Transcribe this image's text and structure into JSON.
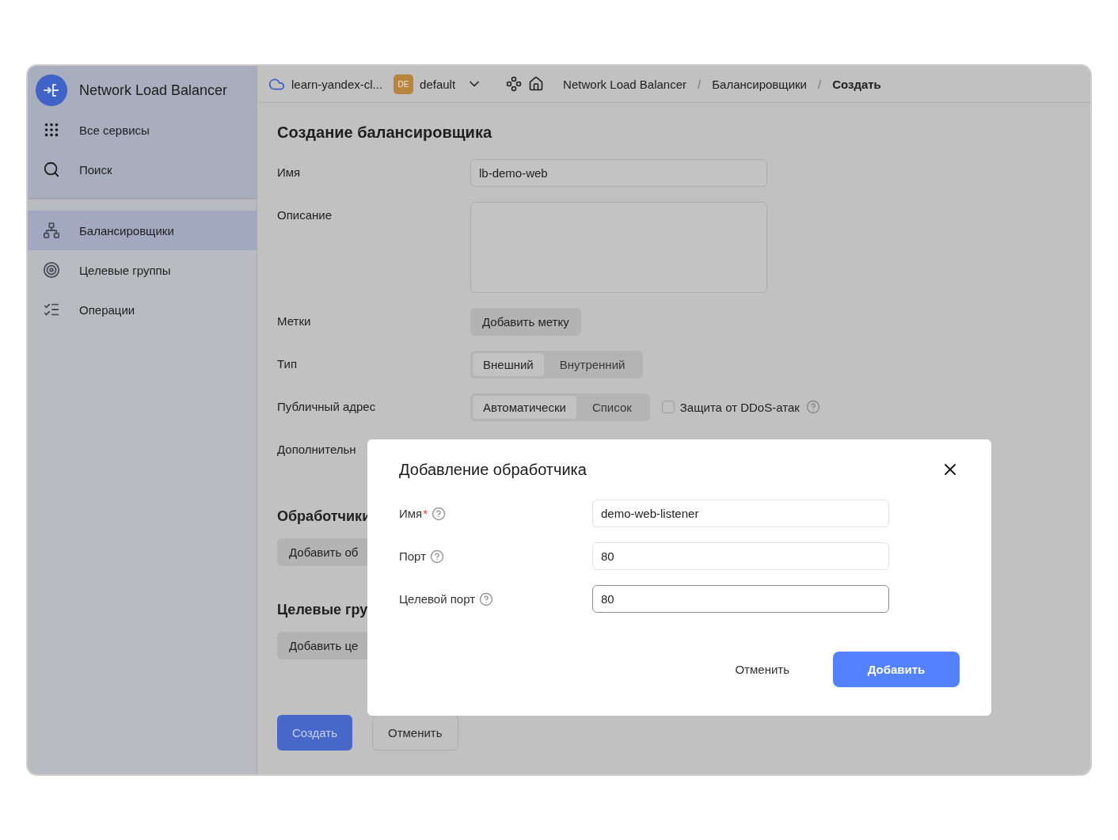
{
  "sidebar": {
    "service_title": "Network Load Balancer",
    "top_items": [
      {
        "label": "Все сервисы"
      },
      {
        "label": "Поиск"
      }
    ],
    "nav_items": [
      {
        "label": "Балансировщики",
        "selected": true
      },
      {
        "label": "Целевые группы",
        "selected": false
      },
      {
        "label": "Операции",
        "selected": false
      }
    ]
  },
  "topbar": {
    "cloud": "learn-yandex-cl...",
    "folder_badge": "DE",
    "folder": "default",
    "separator": "/",
    "breadcrumbs": [
      {
        "label": "Network Load Balancer",
        "current": false
      },
      {
        "label": "Балансировщики",
        "current": false
      },
      {
        "label": "Создать",
        "current": true
      }
    ]
  },
  "form": {
    "title": "Создание балансировщика",
    "fields": [
      {
        "kind": "text",
        "label": "Имя",
        "value": "lb-demo-web"
      },
      {
        "kind": "textarea",
        "label": "Описание"
      },
      {
        "kind": "button",
        "label": "Метки",
        "button": "Добавить метку"
      },
      {
        "kind": "segmented",
        "label": "Тип",
        "options": [
          {
            "label": "Внешний",
            "selected": true
          },
          {
            "label": "Внутренний",
            "selected": false
          }
        ]
      },
      {
        "kind": "segmented",
        "label": "Публичный адрес",
        "options": [
          {
            "label": "Автоматически",
            "selected": true
          },
          {
            "label": "Список",
            "selected": false
          }
        ],
        "checkbox": {
          "label": "Защита от DDoS-атак",
          "checked": false
        }
      },
      {
        "kind": "label",
        "label": "Дополнительн"
      }
    ],
    "sections": [
      {
        "title": "Обработчики",
        "button": "Добавить об"
      },
      {
        "title": "Целевые гру",
        "button": "Добавить це"
      }
    ],
    "actions": [
      {
        "label": "Создать",
        "kind": "primary"
      },
      {
        "label": "Отменить",
        "kind": "secondary"
      }
    ]
  },
  "dialog": {
    "title": "Добавление обработчика",
    "required_mark": "*",
    "fields": [
      {
        "label": "Имя",
        "required": true,
        "value": "demo-web-listener",
        "focused": false
      },
      {
        "label": "Порт",
        "required": false,
        "value": "80",
        "focused": false
      },
      {
        "label": "Целевой порт",
        "required": false,
        "value": "80",
        "focused": true
      }
    ],
    "buttons": [
      {
        "label": "Отменить",
        "kind": "flat"
      },
      {
        "label": "Добавить",
        "kind": "primary"
      }
    ]
  }
}
